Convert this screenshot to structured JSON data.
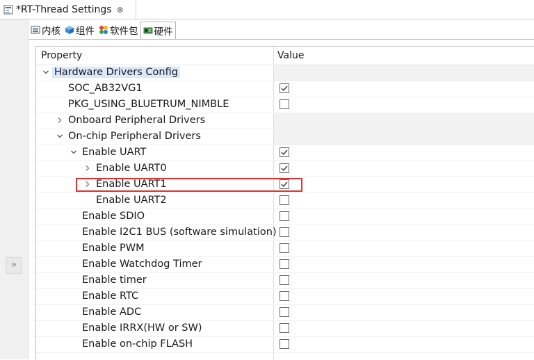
{
  "editor": {
    "tab_title": "*RT-Thread Settings",
    "close_glyph": "⊗"
  },
  "left_strip": {
    "restore_glyph": "»"
  },
  "page_tabs": [
    {
      "label": "内核",
      "icon": "list-icon",
      "active": false
    },
    {
      "label": "组件",
      "icon": "cube-icon",
      "active": false
    },
    {
      "label": "软件包",
      "icon": "package-dots-icon",
      "active": false
    },
    {
      "label": "硬件",
      "icon": "board-icon",
      "active": true
    }
  ],
  "table": {
    "header_property": "Property",
    "header_value": "Value",
    "rows": [
      {
        "label": "Hardware Drivers Config",
        "twisty": "expanded",
        "depth": 0,
        "checkbox": null,
        "selected": true
      },
      {
        "label": "SOC_AB32VG1",
        "twisty": "none",
        "depth": 1,
        "checkbox": true
      },
      {
        "label": "PKG_USING_BLUETRUM_NIMBLE",
        "twisty": "none",
        "depth": 1,
        "checkbox": false
      },
      {
        "label": "Onboard Peripheral Drivers",
        "twisty": "collapsed",
        "depth": 1,
        "checkbox": null
      },
      {
        "label": "On-chip Peripheral Drivers",
        "twisty": "expanded",
        "depth": 1,
        "checkbox": null
      },
      {
        "label": "Enable UART",
        "twisty": "expanded",
        "depth": 2,
        "checkbox": true
      },
      {
        "label": "Enable UART0",
        "twisty": "collapsed",
        "depth": 3,
        "checkbox": true
      },
      {
        "label": "Enable UART1",
        "twisty": "collapsed",
        "depth": 3,
        "checkbox": true
      },
      {
        "label": "Enable UART2",
        "twisty": "none",
        "depth": 3,
        "checkbox": false
      },
      {
        "label": "Enable SDIO",
        "twisty": "none",
        "depth": 2,
        "checkbox": false
      },
      {
        "label": "Enable I2C1 BUS (software simulation)",
        "twisty": "none",
        "depth": 2,
        "checkbox": false
      },
      {
        "label": "Enable PWM",
        "twisty": "none",
        "depth": 2,
        "checkbox": false
      },
      {
        "label": "Enable Watchdog Timer",
        "twisty": "none",
        "depth": 2,
        "checkbox": false
      },
      {
        "label": "Enable timer",
        "twisty": "none",
        "depth": 2,
        "checkbox": false
      },
      {
        "label": "Enable RTC",
        "twisty": "none",
        "depth": 2,
        "checkbox": false
      },
      {
        "label": "Enable ADC",
        "twisty": "none",
        "depth": 2,
        "checkbox": false
      },
      {
        "label": "Enable IRRX(HW or SW)",
        "twisty": "none",
        "depth": 2,
        "checkbox": false
      },
      {
        "label": "Enable on-chip FLASH",
        "twisty": "none",
        "depth": 2,
        "checkbox": false
      }
    ]
  },
  "highlight": {
    "color": "#e0302d",
    "target": "Enable UART1"
  },
  "colors": {
    "selection": "#d9e8fb",
    "group_value_bg": "#f2f2f2",
    "accent": "#6b8ab3"
  }
}
